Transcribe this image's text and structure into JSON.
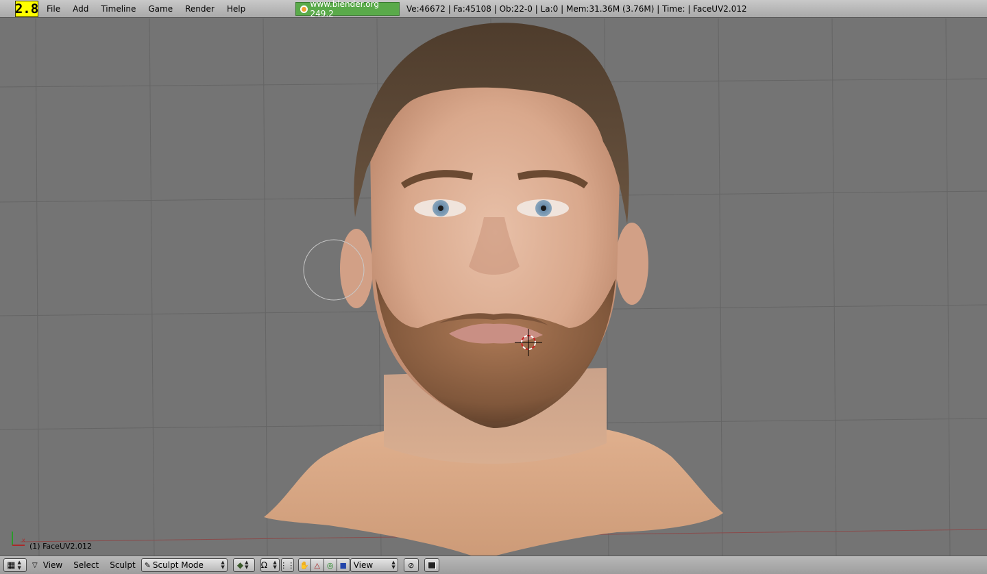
{
  "app": {
    "logo_text": "2.8",
    "accent": "#ffff00"
  },
  "top_menu": {
    "items": [
      {
        "label": "File"
      },
      {
        "label": "Add"
      },
      {
        "label": "Timeline"
      },
      {
        "label": "Game"
      },
      {
        "label": "Render"
      },
      {
        "label": "Help"
      }
    ]
  },
  "info": {
    "version_badge": "www.blender.org 249.2",
    "stats": "Ve:46672 | Fa:45108 | Ob:22-0 | La:0  | Mem:31.36M (3.76M)  | Time: | FaceUV2.012"
  },
  "viewport": {
    "object_label": "(1) FaceUV2.012",
    "background": "#747474"
  },
  "bottom_bar": {
    "menus": [
      {
        "label": "View"
      },
      {
        "label": "Select"
      },
      {
        "label": "Sculpt"
      }
    ],
    "mode_select": {
      "value": "Sculpt Mode"
    },
    "orientation_select": {
      "value": "View"
    }
  }
}
